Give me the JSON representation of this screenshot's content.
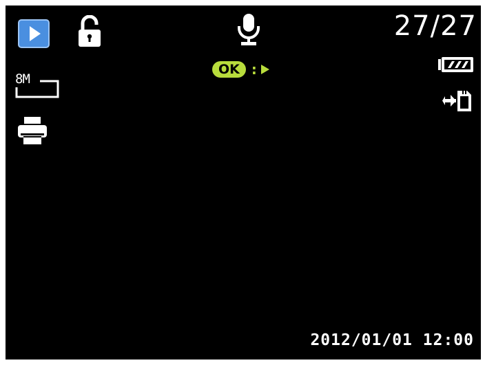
{
  "screen": {
    "background": "#000000"
  },
  "status_bar": {
    "mode_icon": "playback-mode-icon",
    "protect_icon": "unlocked-padlock-icon",
    "voice_memo_icon": "microphone-icon",
    "counter": "27/27"
  },
  "voice_memo_hint": {
    "button_label": "OK",
    "separator": ":",
    "action_icon": "play-triangle-icon",
    "accent_color": "#b8dc3c"
  },
  "left_indicators": {
    "resolution_label": "8M",
    "print_icon": "printer-icon"
  },
  "right_indicators": {
    "battery_icon": "battery-full-icon",
    "transfer_icon": "memory-card-transfer-icon"
  },
  "footer": {
    "datetime": "2012/01/01 12:00"
  },
  "colors": {
    "mode_icon_fill": "#4a8fe0",
    "foreground": "#ffffff"
  }
}
